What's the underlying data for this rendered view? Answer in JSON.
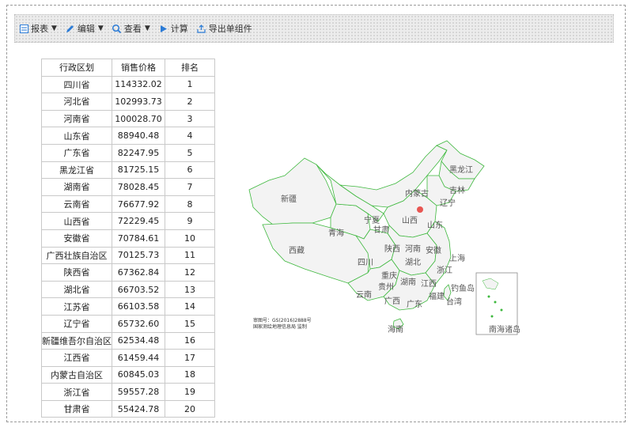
{
  "toolbar": {
    "report_label": "报表",
    "edit_label": "编辑",
    "view_label": "查看",
    "calc_label": "计算",
    "export_label": "导出单组件"
  },
  "table": {
    "headers": [
      "行政区划",
      "销售价格",
      "排名"
    ],
    "rows": [
      [
        "四川省",
        "114332.02",
        "1"
      ],
      [
        "河北省",
        "102993.73",
        "2"
      ],
      [
        "河南省",
        "100028.70",
        "3"
      ],
      [
        "山东省",
        "88940.48",
        "4"
      ],
      [
        "广东省",
        "82247.95",
        "5"
      ],
      [
        "黑龙江省",
        "81725.15",
        "6"
      ],
      [
        "湖南省",
        "78028.45",
        "7"
      ],
      [
        "云南省",
        "76677.92",
        "8"
      ],
      [
        "山西省",
        "72229.45",
        "9"
      ],
      [
        "安徽省",
        "70784.61",
        "10"
      ],
      [
        "广西壮族自治区",
        "70125.73",
        "11"
      ],
      [
        "陕西省",
        "67362.84",
        "12"
      ],
      [
        "湖北省",
        "66703.52",
        "13"
      ],
      [
        "江苏省",
        "66103.58",
        "14"
      ],
      [
        "辽宁省",
        "65732.60",
        "15"
      ],
      [
        "新疆维吾尔自治区",
        "62534.48",
        "16"
      ],
      [
        "江西省",
        "61459.44",
        "17"
      ],
      [
        "内蒙古自治区",
        "60845.03",
        "18"
      ],
      [
        "浙江省",
        "59557.28",
        "19"
      ],
      [
        "甘肃省",
        "55424.78",
        "20"
      ]
    ]
  },
  "map": {
    "province_labels": [
      "新疆",
      "西藏",
      "青海",
      "内蒙古",
      "黑龙江",
      "吉林",
      "辽宁",
      "宁夏",
      "甘肃",
      "山西",
      "陕西",
      "河南",
      "山东",
      "四川",
      "重庆",
      "湖北",
      "安徽",
      "上海",
      "贵州",
      "湖南",
      "江西",
      "浙江",
      "云南",
      "广西",
      "广东",
      "福建",
      "台湾",
      "海南",
      "钓鱼岛",
      "南海诸岛"
    ],
    "inset_label": "南海诸岛",
    "note_line1": "审图号：GS(2016)2888号",
    "note_line2": "国家测绘地理信息局 监制",
    "border_color": "#3db83d",
    "fill_color": "#f3f3f3",
    "marker_color": "#e53935"
  },
  "colors": {
    "icon_blue": "#2b7bd6",
    "toolbar_bg": "#ececec"
  }
}
